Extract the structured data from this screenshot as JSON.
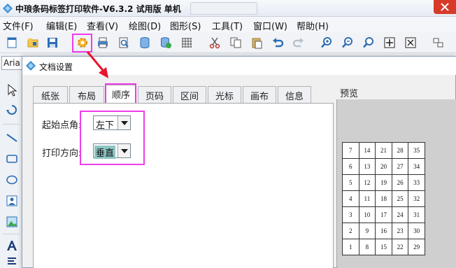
{
  "window": {
    "title": "中琅条码标签打印软件-V6.3.2 试用版 单机"
  },
  "menu": [
    "文件(F)",
    "编辑(E)",
    "查看(V)",
    "绘图(D)",
    "图形(S)",
    "工具(T)",
    "窗口(W)",
    "帮助(H)"
  ],
  "toolbar": {
    "icons": [
      "new-document-icon",
      "open-folder-icon",
      "save-icon",
      "document-settings-icon",
      "print-icon",
      "print-preview-icon",
      "database-icon",
      "database-add-icon",
      "grid-icon",
      "cut-icon",
      "copy-icon",
      "paste-icon",
      "undo-icon",
      "redo-icon",
      "zoom-in-icon",
      "zoom-out-icon",
      "zoom-fit-icon",
      "fit-width-icon",
      "fit-page-icon",
      "tile-icon"
    ]
  },
  "fontbar": {
    "font_value": "Aria"
  },
  "sidebar": {
    "icons": [
      "select-arrow-icon",
      "rotate-icon",
      "line-icon",
      "rectangle-icon",
      "ellipse-icon",
      "image-icon",
      "picture-icon",
      "text-icon",
      "format-text-icon"
    ]
  },
  "dialog": {
    "title": "文档设置",
    "tabs": [
      "纸张",
      "布局",
      "顺序",
      "页码",
      "区间",
      "光标",
      "画布",
      "信息"
    ],
    "active_tab": "顺序",
    "fields": {
      "start_corner_label": "起始点角:",
      "start_corner_value": "左下",
      "print_direction_label": "打印方向:",
      "print_direction_value": "垂直"
    },
    "preview": {
      "label": "预览",
      "grid": [
        [
          "7",
          "14",
          "21",
          "28",
          "35"
        ],
        [
          "6",
          "13",
          "20",
          "27",
          "34"
        ],
        [
          "5",
          "12",
          "19",
          "26",
          "33"
        ],
        [
          "4",
          "11",
          "18",
          "25",
          "32"
        ],
        [
          "3",
          "10",
          "17",
          "24",
          "31"
        ],
        [
          "2",
          "9",
          "16",
          "23",
          "30"
        ],
        [
          "1",
          "8",
          "15",
          "22",
          "29"
        ]
      ]
    }
  },
  "colors": {
    "highlight": "#ee3ee8",
    "arrow": "#e8152b",
    "selection": "#8cc5c4",
    "close_button": "#d83a2a"
  }
}
